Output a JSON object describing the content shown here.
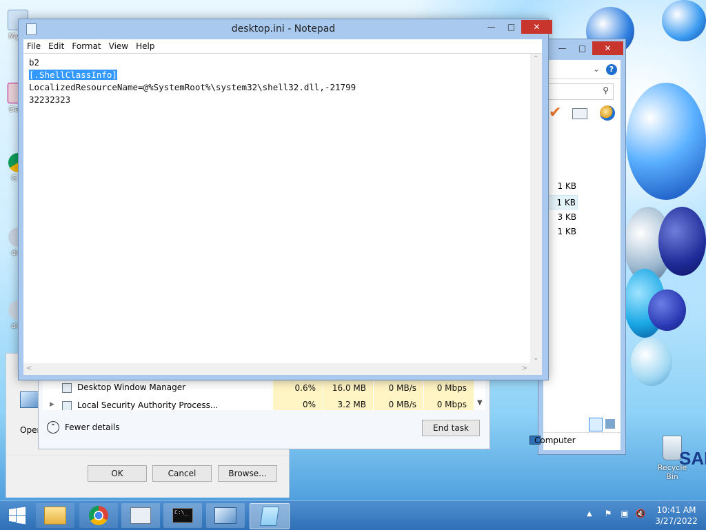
{
  "notepad": {
    "title": "desktop.ini - Notepad",
    "menu": [
      "File",
      "Edit",
      "Format",
      "View",
      "Help"
    ],
    "lines": [
      "b2",
      "[.ShellClassInfo]",
      "LocalizedResourceName=@%SystemRoot%\\system32\\shell32.dll,-21799",
      "32232323"
    ],
    "selected_line_index": 1
  },
  "explorer": {
    "file_sizes": [
      "1 KB",
      "1 KB",
      "3 KB",
      "1 KB"
    ],
    "status_location": "Computer"
  },
  "task_manager": {
    "rows": [
      {
        "name": "Desktop Window Manager",
        "cpu": "0.6%",
        "memory": "16.0 MB",
        "disk": "0 MB/s",
        "network": "0 Mbps"
      },
      {
        "name": "Local Security Authority Process...",
        "cpu": "0%",
        "memory": "3.2 MB",
        "disk": "0 MB/s",
        "network": "0 Mbps"
      }
    ],
    "fewer_details": "Fewer details",
    "end_task": "End task"
  },
  "run_dialog": {
    "open_label": "Open",
    "ok": "OK",
    "cancel": "Cancel",
    "browse": "Browse..."
  },
  "desktop": {
    "icons": [
      "My C",
      "Data",
      "G C",
      "des",
      "des"
    ],
    "recycle_bin": "Recycle Bin",
    "brand_fragment": "SAM"
  },
  "taskbar": {
    "apps": [
      "file-explorer-icon",
      "chrome-icon",
      "task-manager-icon",
      "command-prompt-icon",
      "run-icon",
      "notepad-icon"
    ],
    "cmd_glyph": "C:\\_",
    "time": "10:41 AM",
    "date": "3/27/2022"
  },
  "colors": {
    "selection": "#3399ff",
    "titlebar_active": "#a9c9ee",
    "close_red": "#c7352c"
  }
}
